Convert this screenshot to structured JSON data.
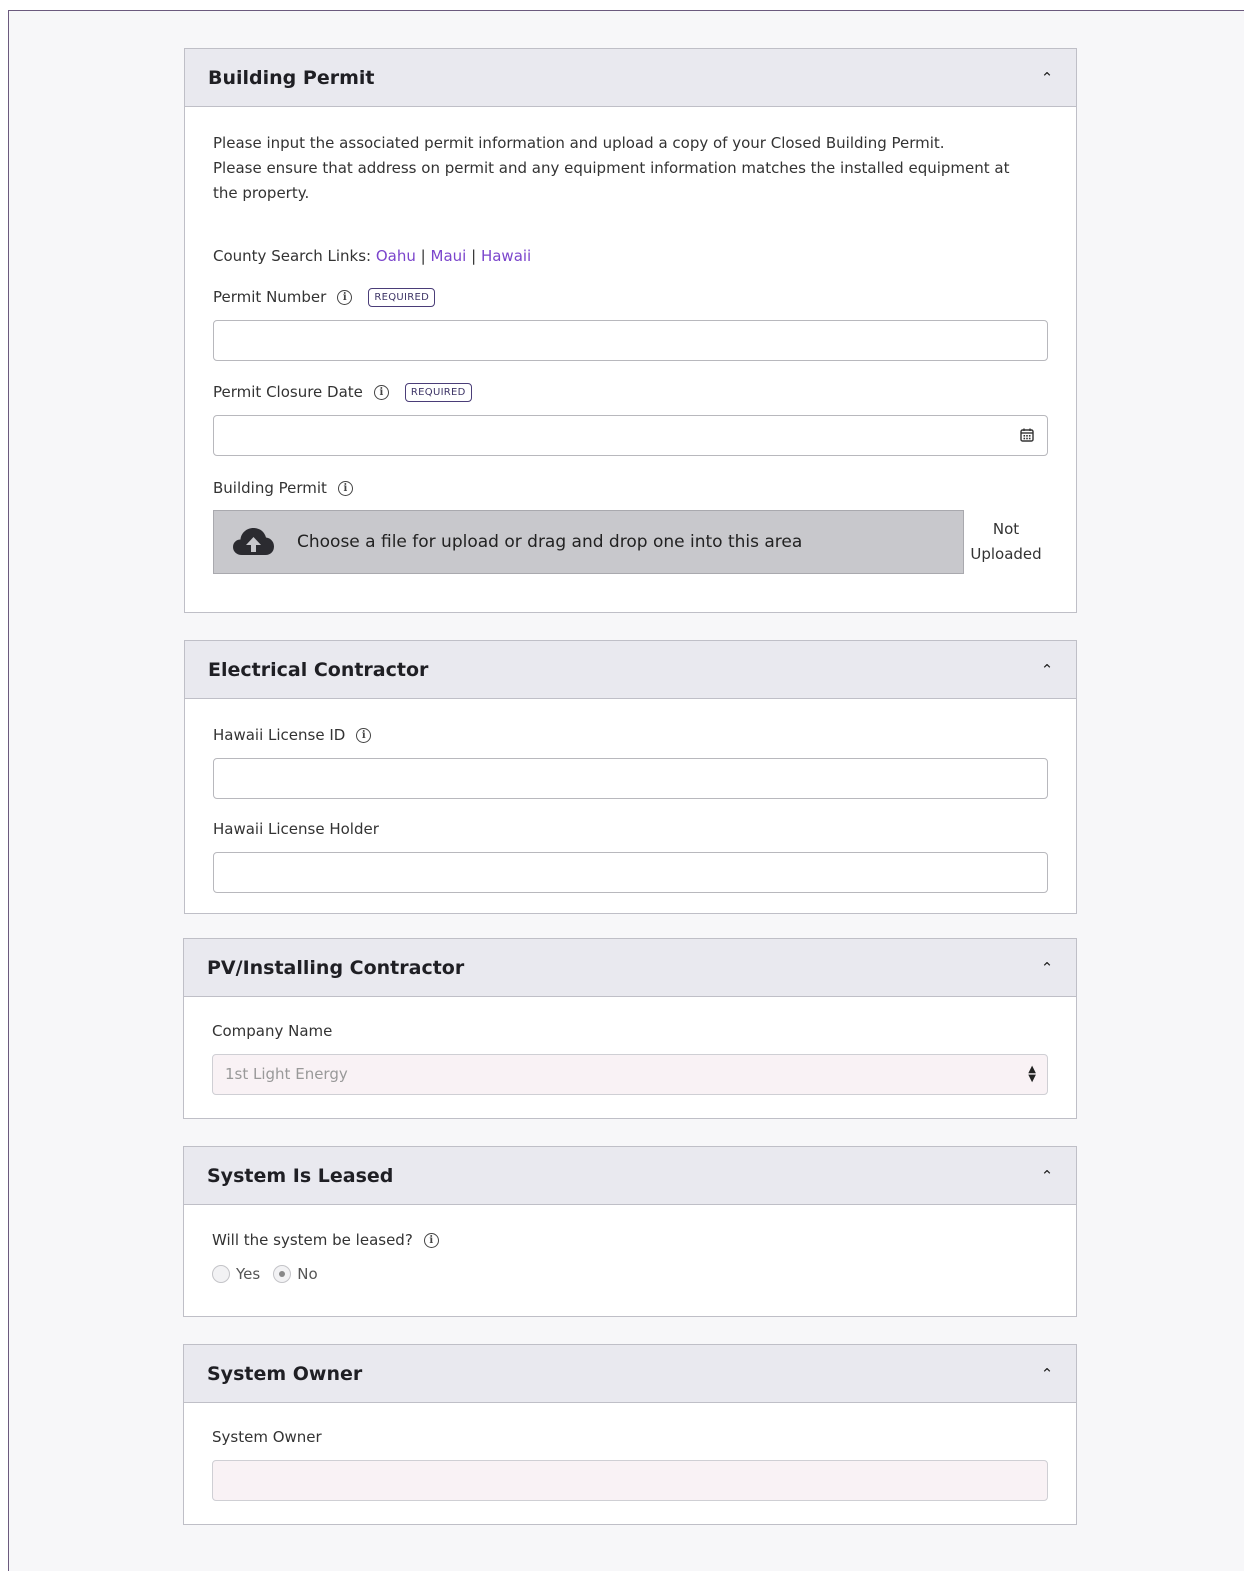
{
  "building_permit": {
    "title": "Building Permit",
    "intro_line1": "Please input the associated permit information and upload a copy of your Closed Building Permit.",
    "intro_line2": "Please ensure that address on permit and any equipment information matches the installed equipment at the property.",
    "county_links_label": "County Search Links:",
    "county_links": [
      "Oahu",
      "Maui",
      "Hawaii"
    ],
    "link_separator": "|",
    "permit_number_label": "Permit Number",
    "permit_number_value": "",
    "required_badge": "REQUIRED",
    "closure_date_label": "Permit Closure Date",
    "closure_date_value": "",
    "upload_label": "Building Permit",
    "upload_text": "Choose a file for upload or drag and drop one into this area",
    "upload_status_line1": "Not",
    "upload_status_line2": "Uploaded"
  },
  "electrical_contractor": {
    "title": "Electrical Contractor",
    "license_id_label": "Hawaii License ID",
    "license_id_value": "",
    "license_holder_label": "Hawaii License Holder",
    "license_holder_value": ""
  },
  "pv_contractor": {
    "title": "PV/Installing Contractor",
    "company_label": "Company Name",
    "company_value": "1st Light Energy"
  },
  "system_leased": {
    "title": "System Is Leased",
    "question": "Will the system be leased?",
    "options": [
      "Yes",
      "No"
    ],
    "selected": "No"
  },
  "system_owner": {
    "title": "System Owner",
    "owner_label": "System Owner",
    "owner_value": ""
  },
  "icons": {
    "collapse": "chevron-up-icon",
    "info": "info-icon",
    "calendar": "calendar-icon",
    "upload": "cloud-upload-icon",
    "select": "select-arrows-icon"
  },
  "colors": {
    "link": "#7b45cc",
    "header_bg": "#e9e9ef",
    "upload_bg": "#c8c8cc",
    "tinted_input": "#f9f2f5"
  }
}
